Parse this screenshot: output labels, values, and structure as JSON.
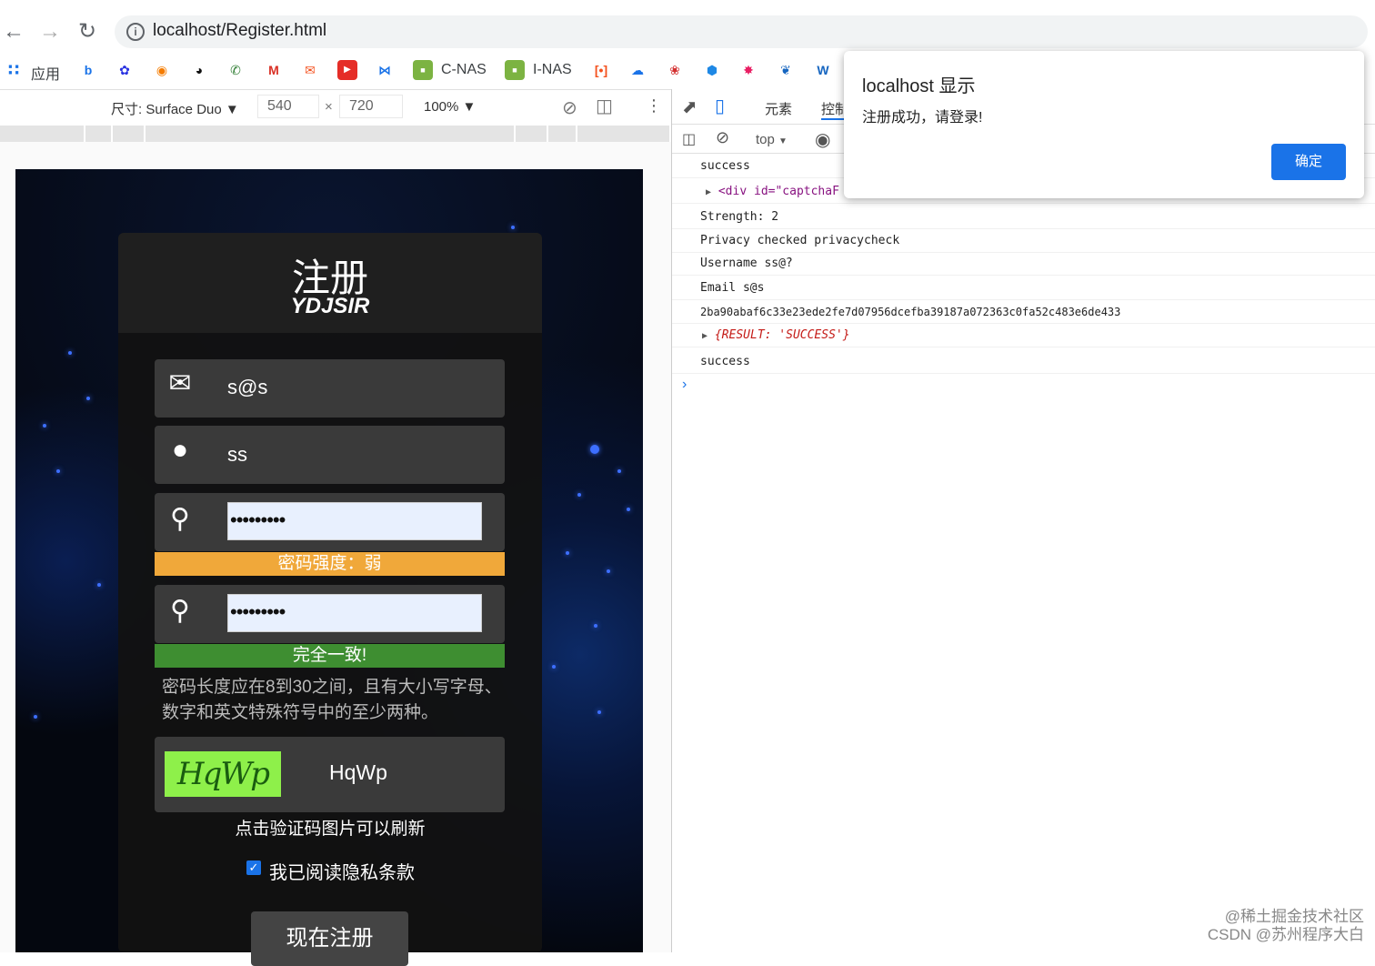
{
  "browser": {
    "url": "localhost/Register.html",
    "bookmarks": {
      "apps_label": "应用",
      "cnas_label": "C-NAS",
      "inas_label": "I-NAS"
    }
  },
  "device_toolbar": {
    "size_label": "尺寸: Surface Duo",
    "width": "540",
    "times": "×",
    "height": "720",
    "zoom": "100%"
  },
  "page": {
    "title": "注册",
    "subtitle": "YDJSIR",
    "email_value": "s@s",
    "username_value": "ss",
    "password_mask": "•••••••••",
    "confirm_mask": "•••••••••",
    "strength_text": "密码强度：弱",
    "strength_color": "#f0a83a",
    "match_text": "完全一致!",
    "match_color": "#3e8e31",
    "hint": "密码长度应在8到30之间，且有大小写字母、数字和英文特殊符号中的至少两种。",
    "captcha_image_text": "HqWp",
    "captcha_value": "HqWp",
    "captcha_tip": "点击验证码图片可以刷新",
    "agree_text": "我已阅读隐私条款",
    "submit_label": "现在注册"
  },
  "devtools": {
    "tab_elements": "元素",
    "tab_console": "控制",
    "context": "top",
    "logs": [
      "success",
      "<div id=\"captchaF",
      "Strength: 2",
      "Privacy checked privacycheck",
      "Username ss@?",
      "Email s@s",
      "2ba90abaf6c33e23ede2fe7d07956dcefba39187a072363c0fa52c483e6de433",
      "{RESULT: 'SUCCESS'}",
      "success"
    ]
  },
  "dialog": {
    "title": "localhost 显示",
    "message": "注册成功，请登录!",
    "ok_label": "确定"
  },
  "watermark": {
    "line1": "@稀土掘金技术社区",
    "line2": "CSDN @苏州程序大白"
  }
}
